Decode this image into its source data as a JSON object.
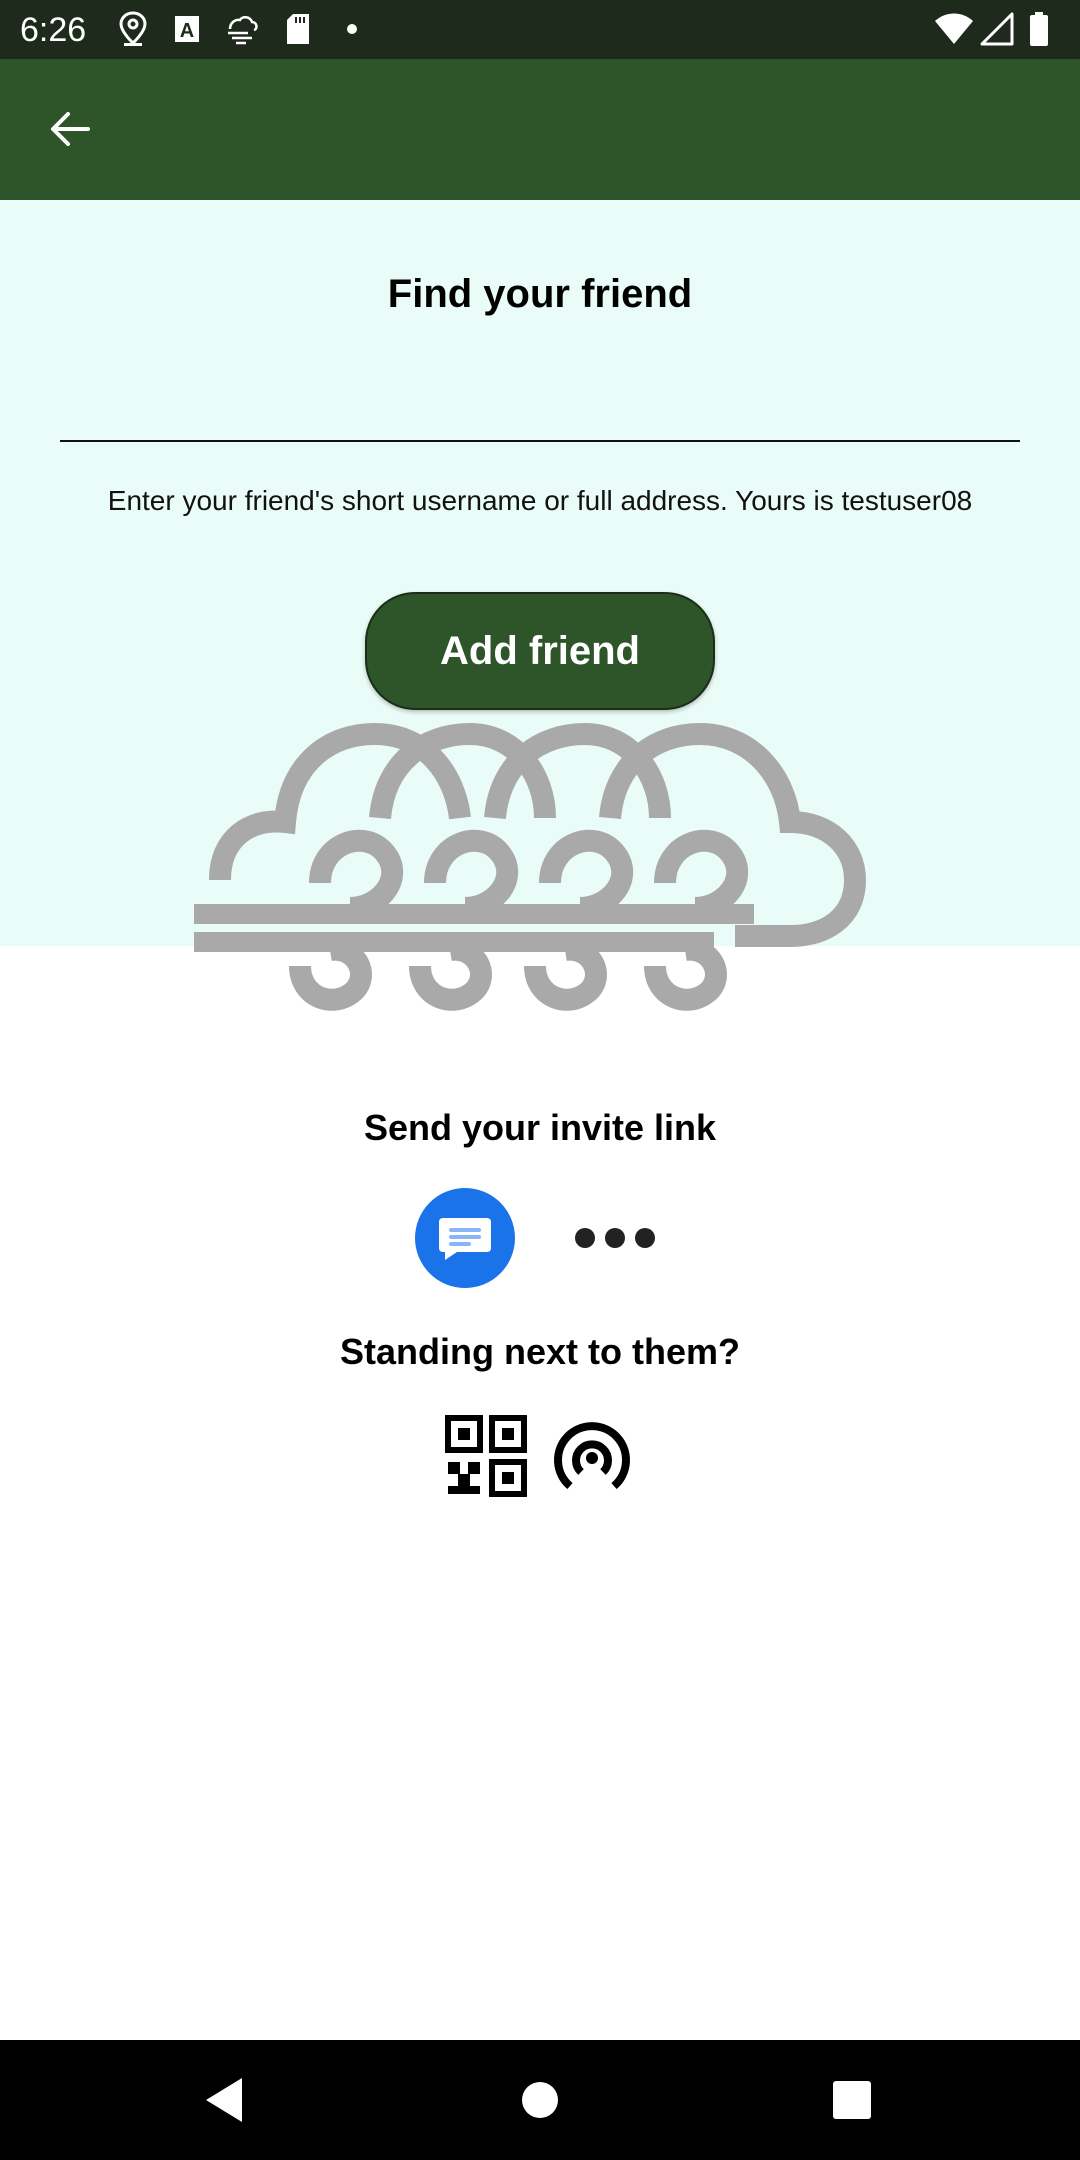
{
  "status_bar": {
    "time": "6:26",
    "left_icons": [
      "location-icon",
      "text-a-icon",
      "weather-wind-icon",
      "sd-card-icon",
      "dot-icon"
    ],
    "right_icons": [
      "wifi-icon",
      "signal-icon",
      "battery-icon"
    ]
  },
  "app_bar": {
    "back_icon": "arrow-back-icon",
    "background": "#2e5429"
  },
  "find": {
    "title": "Find your friend",
    "input_value": "",
    "helper": "Enter your friend's short username or full address. Yours is testuser08",
    "add_button": "Add friend"
  },
  "invite": {
    "title": "Send your invite link",
    "share_icons": [
      "messages-icon",
      "more-horiz-icon"
    ],
    "messages_color": "#1a73e8"
  },
  "nearby": {
    "title": "Standing next to them?",
    "icons": [
      "qr-code-icon",
      "nearby-signal-icon"
    ]
  },
  "colors": {
    "accent": "#2e5429",
    "section_background": "#eafcf7",
    "graphic": "#a9a9a9"
  }
}
